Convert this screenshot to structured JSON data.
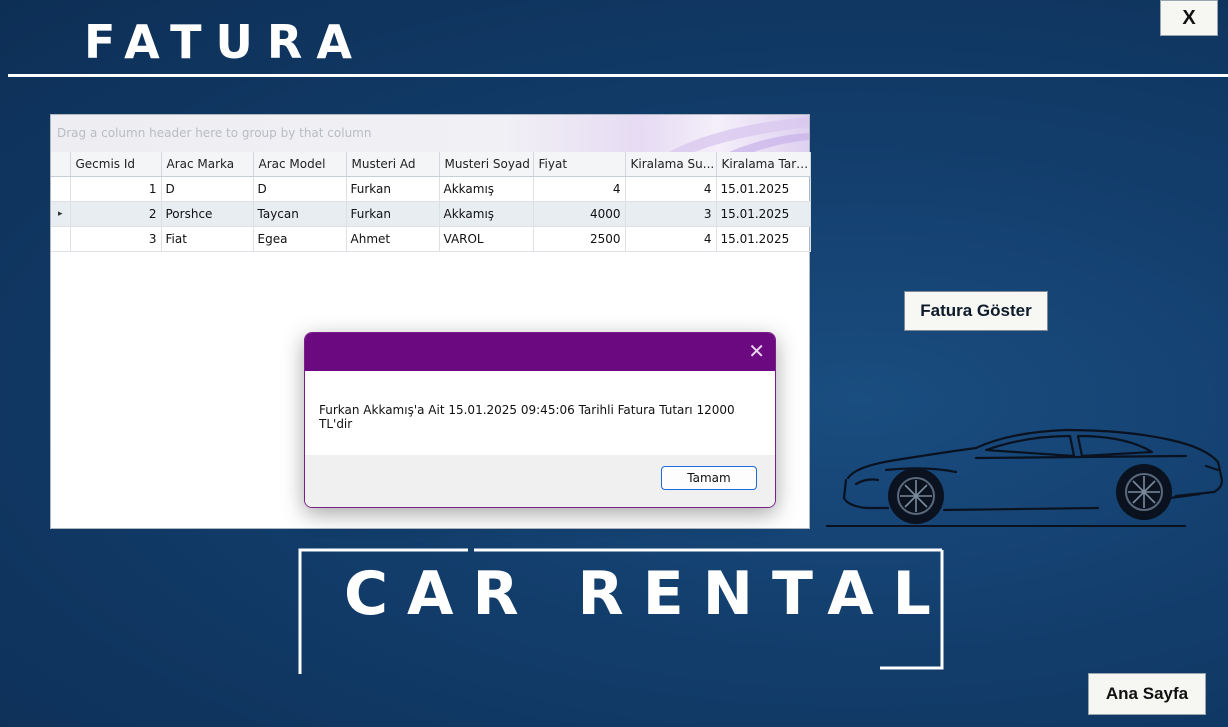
{
  "header": {
    "title": "FATURA",
    "close_label": "X"
  },
  "grid": {
    "group_panel_hint": "Drag a column header here to group by that column",
    "columns": [
      "Gecmis Id",
      "Arac Marka",
      "Arac Model",
      "Musteri Ad",
      "Musteri Soyad",
      "Fiyat",
      "Kiralama Su...",
      "Kiralama Tarihi"
    ],
    "row_indicator": "▸",
    "rows": [
      [
        "1",
        "D",
        "D",
        "Furkan",
        "Akkamış",
        "4",
        "4",
        "15.01.2025"
      ],
      [
        "2",
        "Porshce",
        "Taycan",
        "Furkan",
        "Akkamış",
        "4000",
        "3",
        "15.01.2025"
      ],
      [
        "3",
        "Fiat",
        "Egea",
        "Ahmet",
        "VAROL",
        "2500",
        "4",
        "15.01.2025"
      ]
    ],
    "selected_row": 1
  },
  "dialog": {
    "close_symbol": "✕",
    "message": "Furkan Akkamış'a Ait 15.01.2025 09:45:06 Tarihli Fatura Tutarı 12000 TL'dir",
    "ok_label": "Tamam"
  },
  "actions": {
    "show_invoice_label": "Fatura Göster",
    "home_label": "Ana Sayfa"
  },
  "banner": {
    "text": "CAR RENTAL"
  },
  "colors": {
    "background": "#123d6b",
    "dialog_bar": "#6b0a80",
    "text_light": "#ffffff"
  },
  "icons": {
    "car": "car-silhouette-icon"
  }
}
